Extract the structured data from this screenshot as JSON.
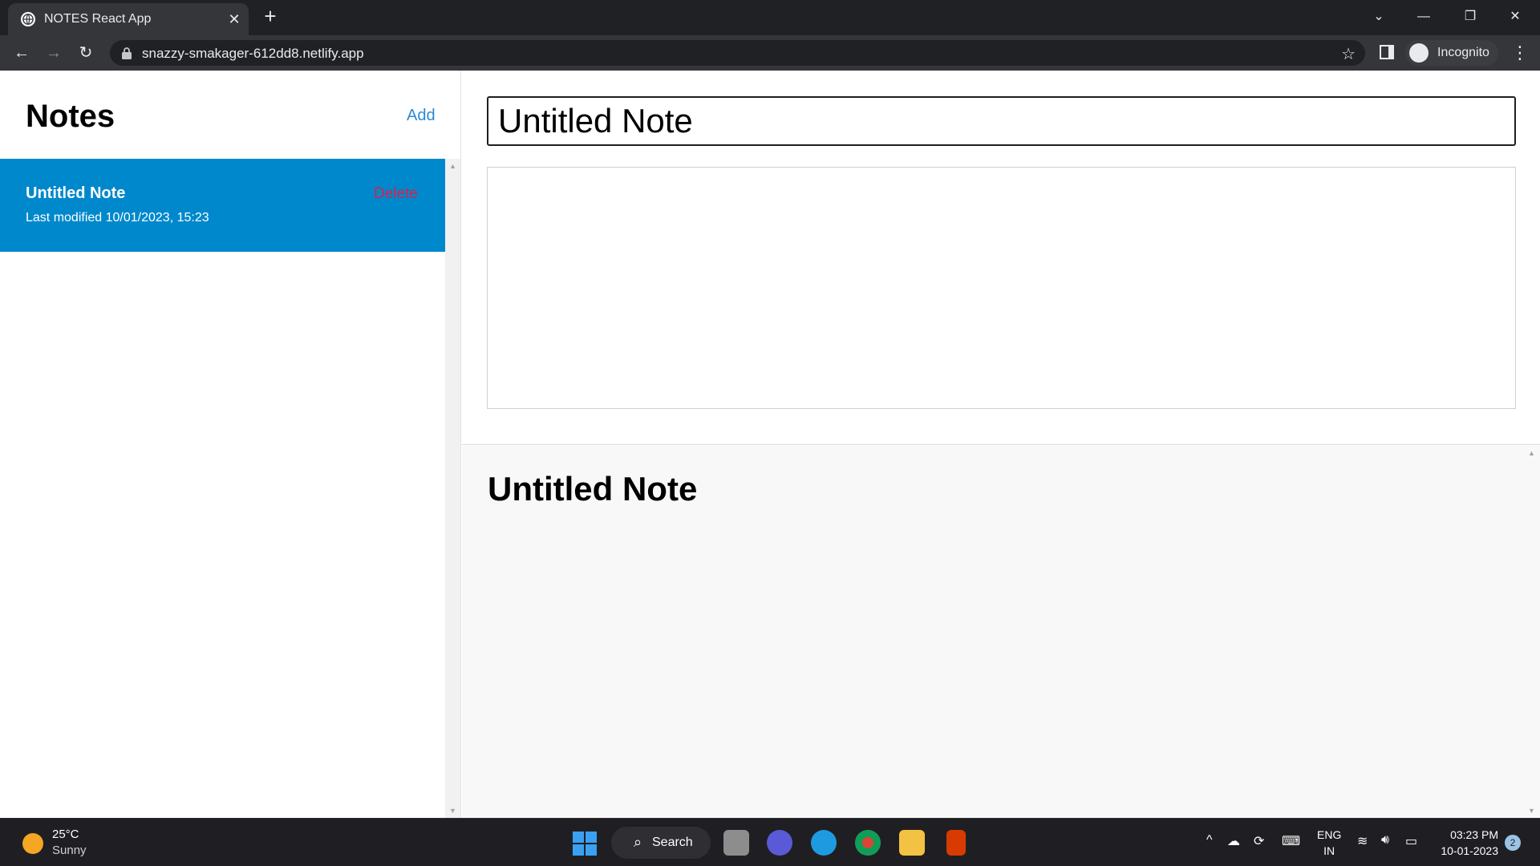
{
  "browser": {
    "tab_title": "NOTES React App",
    "url": "snazzy-smakager-612dd8.netlify.app",
    "profile_label": "Incognito"
  },
  "sidebar": {
    "title": "Notes",
    "add_label": "Add",
    "notes": [
      {
        "title": "Untitled Note",
        "delete_label": "Delete",
        "last_modified": "Last modified 10/01/2023, 15:23"
      }
    ]
  },
  "editor": {
    "title_value": "Untitled Note",
    "body_value": ""
  },
  "preview": {
    "title": "Untitled Note"
  },
  "taskbar": {
    "weather_temp": "25°C",
    "weather_desc": "Sunny",
    "search_label": "Search",
    "lang_line1": "ENG",
    "lang_line2": "IN",
    "time": "03:23 PM",
    "date": "10-01-2023",
    "notification_count": "2"
  },
  "colors": {
    "selected_note_bg": "#0088cc",
    "delete_text": "#d4224e",
    "add_link": "#2a8ad6"
  }
}
